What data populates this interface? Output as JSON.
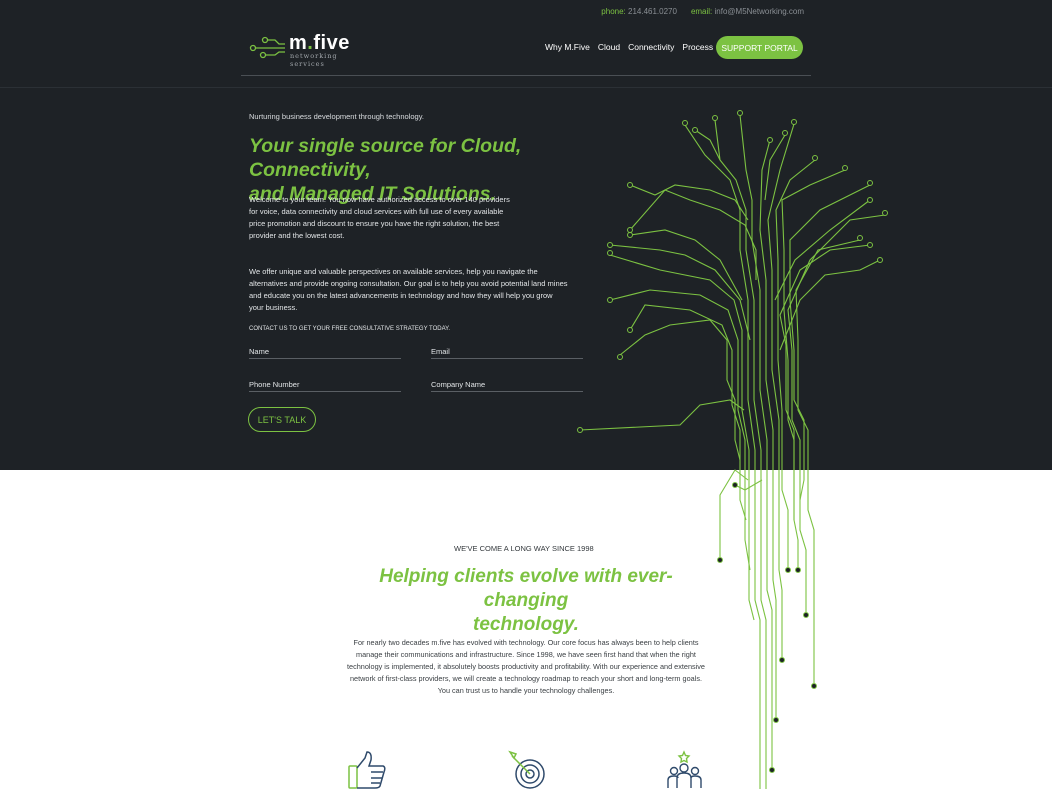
{
  "topbar": {
    "phone_label": "phone:",
    "phone": "214.461.0270",
    "email_label": "email:",
    "email": "info@M5Networking.com"
  },
  "logo": {
    "name": "m.five",
    "sub": "networking services"
  },
  "nav": {
    "items": [
      "Why M.Five",
      "Cloud",
      "Connectivity",
      "Process"
    ],
    "portal": "SUPPORT PORTAL"
  },
  "hero": {
    "tagline": "Nurturing business development through technology.",
    "title_line1": "Your single source for Cloud, Connectivity,",
    "title_line2": "and Managed IT Solutions.",
    "p1": "Welcome to your team. You now have authorized access to over 140 providers for voice, data connectivity and cloud services with full use of every available price promotion and discount to ensure you have the right solution, the best provider and the lowest cost.",
    "p2": "We offer unique and valuable perspectives on available services, help you navigate the alternatives and provide ongoing consultation. Our goal is to help you avoid potential land mines and educate you on the latest advancements in technology and how they will help you grow your business.",
    "cta": "CONTACT US TO GET YOUR FREE CONSULTATIVE STRATEGY TODAY."
  },
  "form": {
    "name": "Name",
    "email": "Email",
    "phone": "Phone Number",
    "company": "Company Name",
    "submit": "LET'S TALK"
  },
  "about": {
    "overline": "WE'VE COME A LONG WAY SINCE 1998",
    "title_line1": "Helping clients evolve with ever-changing",
    "title_line2": "technology.",
    "body": "For nearly two decades m.five has evolved with technology. Our core focus has always been to help clients manage their communications and infrastructure. Since 1998, we have seen first hand that when the right technology is implemented, it absolutely boosts productivity and profitability. With our experience and extensive network of first-class providers, we will create a technology roadmap to reach your short and long-term goals. You can trust us to handle your technology challenges."
  },
  "colors": {
    "accent": "#7cc242",
    "dark": "#1e2226"
  },
  "icons": [
    "thumbs-up-icon",
    "target-icon",
    "team-icon"
  ]
}
